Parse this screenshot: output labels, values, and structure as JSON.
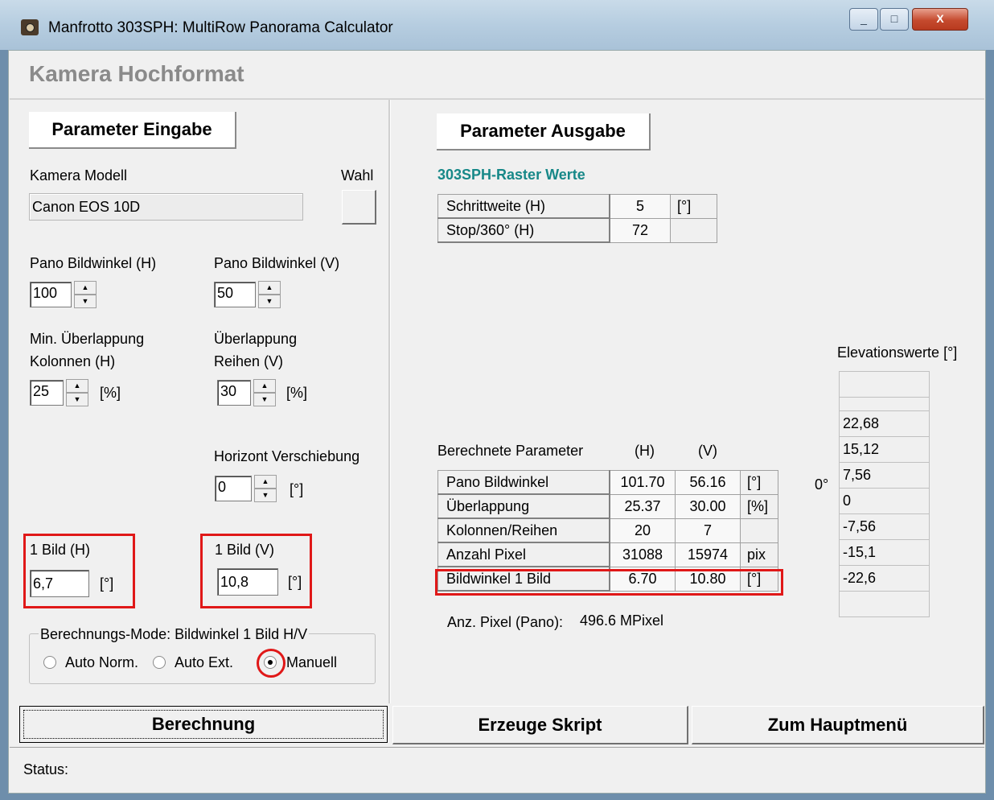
{
  "window": {
    "title": "Manfrotto  303SPH: MultiRow Panorama Calculator",
    "controls": [
      "_",
      "□",
      "X"
    ]
  },
  "heading": "Kamera Hochformat",
  "left": {
    "section_button": "Parameter Eingabe",
    "camera_label": "Kamera Modell",
    "camera_value": "Canon EOS 10D",
    "wahl_label": "Wahl",
    "pano_h_label": "Pano Bildwinkel (H)",
    "pano_h_value": "100",
    "pano_v_label": "Pano Bildwinkel (V)",
    "pano_v_value": "50",
    "overlap_cols_label1": "Min. Überlappung",
    "overlap_cols_label2": "Kolonnen (H)",
    "overlap_cols_value": "25",
    "overlap_cols_unit": "[%]",
    "overlap_rows_label1": "Überlappung",
    "overlap_rows_label2": "Reihen (V)",
    "overlap_rows_value": "30",
    "overlap_rows_unit": "[%]",
    "horizon_label": "Horizont Verschiebung",
    "horizon_value": "0",
    "horizon_unit": "[°]",
    "bild_h_label": "1 Bild (H)",
    "bild_h_value": "6,7",
    "bild_h_unit": "[°]",
    "bild_v_label": "1 Bild (V)",
    "bild_v_value": "10,8",
    "bild_v_unit": "[°]",
    "mode_group_label": "Berechnungs-Mode: Bildwinkel 1 Bild H/V",
    "mode_options": [
      "Auto Norm.",
      "Auto Ext.",
      "Manuell"
    ],
    "mode_selected": "Manuell"
  },
  "right": {
    "section_button": "Parameter Ausgabe",
    "raster_title": "303SPH-Raster Werte",
    "raster_rows": [
      {
        "label": "Schrittweite (H)",
        "value": "5",
        "unit": "[°]"
      },
      {
        "label": "Stop/360° (H)",
        "value": "72",
        "unit": ""
      }
    ],
    "calc_title": "Berechnete Parameter",
    "col_h": "(H)",
    "col_v": "(V)",
    "calc_rows": [
      {
        "label": "Pano Bildwinkel",
        "h": "101.70",
        "v": "56.16",
        "unit": "[°]"
      },
      {
        "label": "Überlappung",
        "h": "25.37",
        "v": "30.00",
        "unit": "[%]"
      },
      {
        "label": "Kolonnen/Reihen",
        "h": "20",
        "v": "7",
        "unit": ""
      },
      {
        "label": "Anzahl Pixel",
        "h": "31088",
        "v": "15974",
        "unit": "pix"
      },
      {
        "label": "Bildwinkel 1 Bild",
        "h": "6.70",
        "v": "10.80",
        "unit": "[°]"
      }
    ],
    "pano_pixels_label": "Anz. Pixel (Pano):",
    "pano_pixels_value": "496.6 MPixel",
    "elevation_title": "Elevationswerte [°]",
    "zero_marker": "0°",
    "elevations": [
      "",
      "",
      "22,68",
      "15,12",
      "7,56",
      "0",
      "-7,56",
      "-15,1",
      "-22,6",
      ""
    ]
  },
  "buttons": {
    "calc": "Berechnung",
    "script": "Erzeuge Skript",
    "main_menu": "Zum Hauptmenü"
  },
  "status_label": "Status:"
}
